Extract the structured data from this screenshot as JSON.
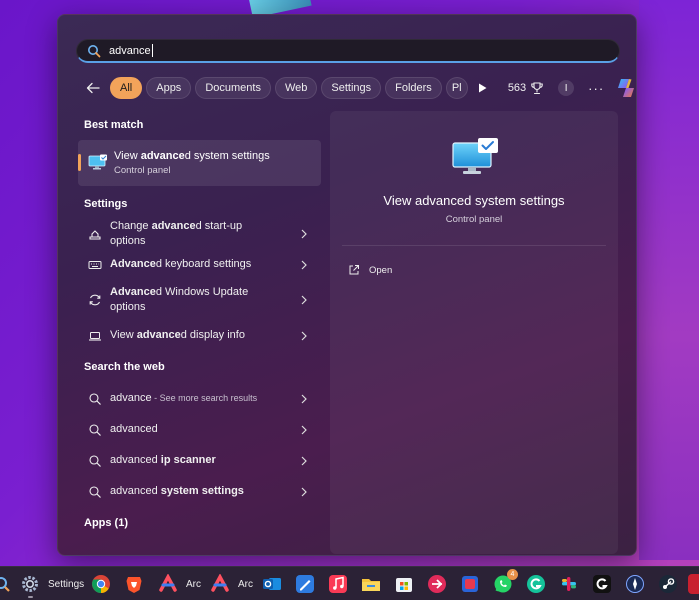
{
  "search": {
    "query": "advance"
  },
  "filters": {
    "chips": [
      "All",
      "Apps",
      "Documents",
      "Web",
      "Settings",
      "Folders",
      "Pl"
    ],
    "active": "All",
    "rewards_count": "563",
    "user_initial": "I"
  },
  "best_match": {
    "section": "Best match",
    "title_bold": "advance",
    "title_pre": "View ",
    "title_post": "d system settings",
    "subtitle": "Control panel"
  },
  "settings": {
    "section": "Settings",
    "items": [
      {
        "pre": "Change ",
        "bold": "advance",
        "post": "d start-up options",
        "icon": "bootup-icon"
      },
      {
        "pre": "",
        "bold": "Advance",
        "post": "d keyboard settings",
        "icon": "keyboard-icon"
      },
      {
        "pre": "",
        "bold": "Advance",
        "post": "d Windows Update options",
        "icon": "update-icon"
      },
      {
        "pre": "View ",
        "bold": "advance",
        "post": "d display info",
        "icon": "laptop-icon"
      }
    ]
  },
  "web": {
    "section": "Search the web",
    "items": [
      {
        "pre": "advance",
        "bold": "",
        "post": "",
        "sub": " - See more search results"
      },
      {
        "pre": "advanced",
        "bold": "",
        "post": "",
        "sub": ""
      },
      {
        "pre": "advanced ",
        "bold": "ip scanner",
        "post": "",
        "sub": ""
      },
      {
        "pre": "advanced ",
        "bold": "system settings",
        "post": "",
        "sub": ""
      }
    ]
  },
  "apps": {
    "section": "Apps (1)"
  },
  "detail": {
    "title": "View advanced system settings",
    "subtitle": "Control panel",
    "action": "Open"
  },
  "taskbar": {
    "settings_label": "Settings",
    "arc_label_1": "Arc",
    "arc_label_2": "Arc",
    "whatsapp_badge": "4"
  },
  "colors": {
    "accent": "#f2a35a",
    "search_underline": "#5aa0e6",
    "panel_bg": "#3a2150"
  }
}
